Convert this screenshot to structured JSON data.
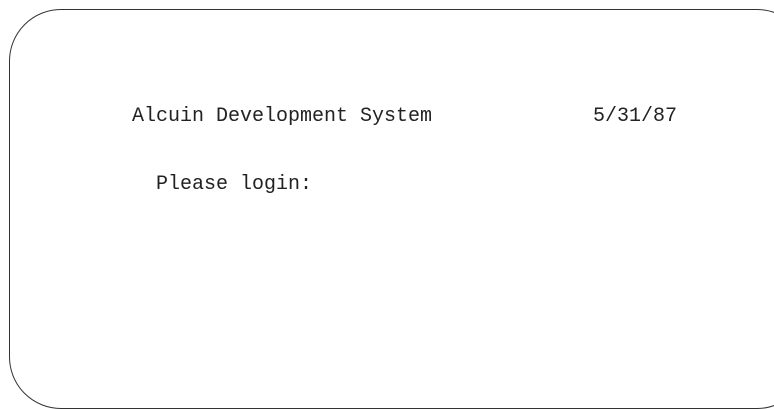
{
  "terminal": {
    "system_name": "Alcuin Development System",
    "date": "5/31/87",
    "prompt": "Please login:"
  }
}
